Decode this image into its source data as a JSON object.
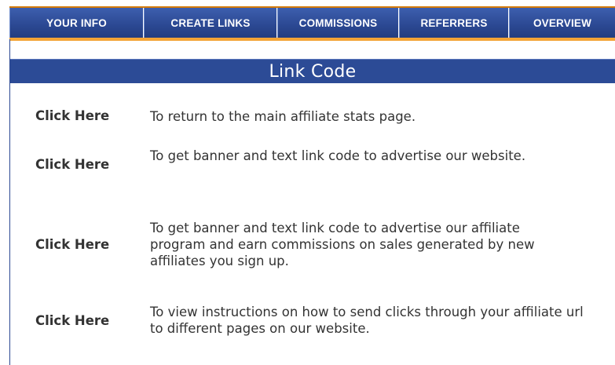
{
  "nav": {
    "tabs": [
      {
        "label": "YOUR INFO"
      },
      {
        "label": "CREATE LINKS"
      },
      {
        "label": "COMMISSIONS"
      },
      {
        "label": "REFERRERS"
      },
      {
        "label": "OVERVIEW"
      }
    ]
  },
  "panel": {
    "title": "Link Code",
    "rows": [
      {
        "link": "Click Here",
        "description": "To return to the main affiliate stats page."
      },
      {
        "link": "Click Here",
        "description": "To get banner and text link code to advertise our website."
      },
      {
        "link": "Click Here",
        "description": "To get banner and text link code to advertise our affiliate program and earn commissions on sales generated by new affiliates you sign up."
      },
      {
        "link": "Click Here",
        "description": "To view instructions on how to send clicks through your affiliate url to different pages on our website."
      }
    ]
  },
  "colors": {
    "nav_tab_bg": "#2b4892",
    "nav_accent": "#f59a14",
    "header_bg": "#2c4b96",
    "text": "#333333"
  }
}
